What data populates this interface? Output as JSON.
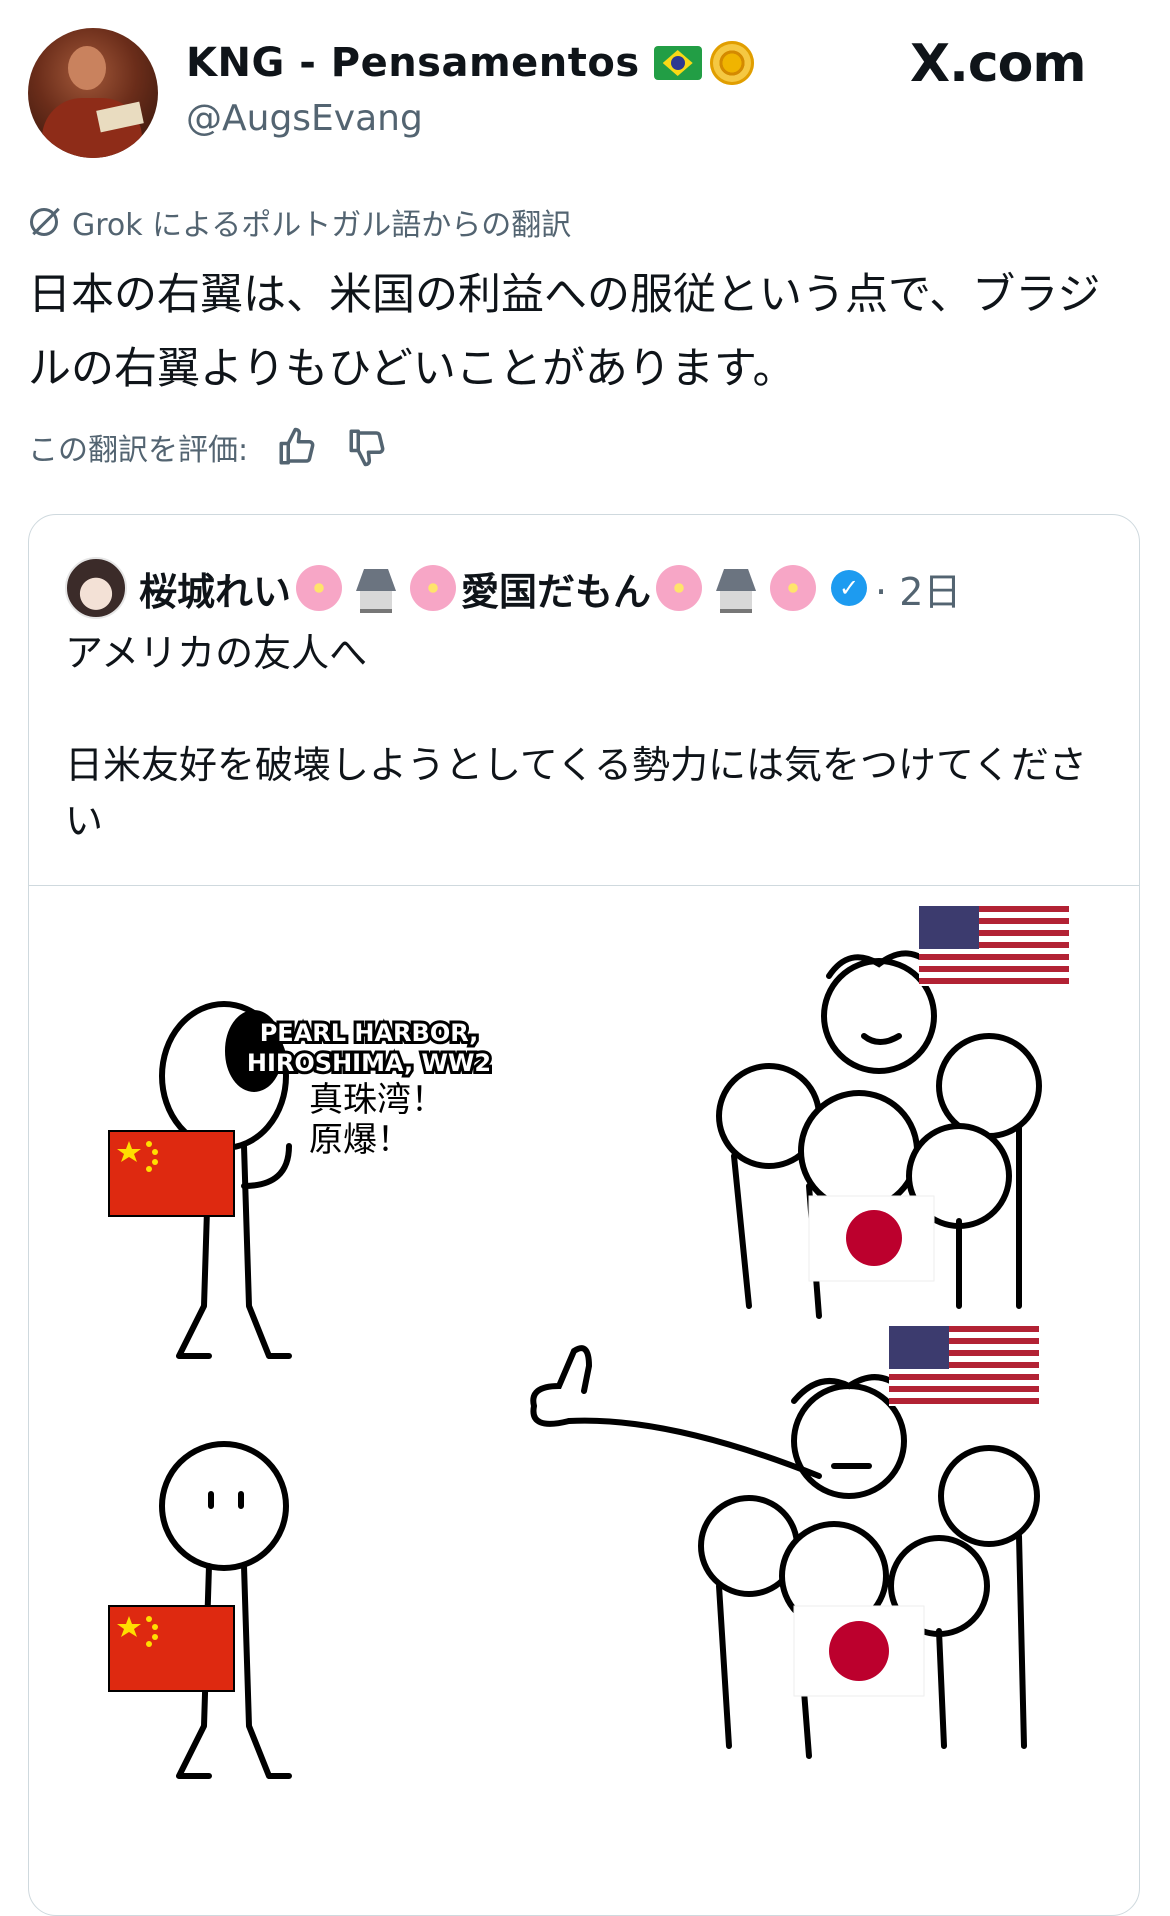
{
  "post": {
    "author_name": "KNG - Pensamentos",
    "author_handle": "@AugsEvang",
    "brand": "X.com",
    "translation_label": "Grok によるポルトガル語からの翻訳",
    "translated_text": "日本の右翼は、米国の利益への服従という点で、ブラジルの右翼よりもひどいことがあります。",
    "rate_label": "この翻訳を評価:",
    "icons": [
      "brazil-flag-emoji",
      "emblem-emoji",
      "grok-icon",
      "thumbs-up-icon",
      "thumbs-down-icon"
    ]
  },
  "quote": {
    "name_part1": "桜城れい",
    "name_part2": "愛国だもん",
    "date": "· 2日",
    "text": "アメリカの友人へ\n\n日米友好を破壊しようとしてくる勢力には気をつけてください",
    "icons": [
      "sakura-emoji",
      "castle-emoji",
      "verified-badge-icon"
    ]
  },
  "meme": {
    "caption_en_line1": "PEARL HARBOR,",
    "caption_en_line2": "HIROSHIMA, WW2",
    "caption_jp_line1": "真珠湾！",
    "caption_jp_line2": "原爆！",
    "colors": {
      "china_red": "#de2910",
      "china_star": "#ffde00",
      "japan_red": "#bc002d",
      "us_blue": "#3c3b6e",
      "us_red": "#b22234"
    }
  }
}
